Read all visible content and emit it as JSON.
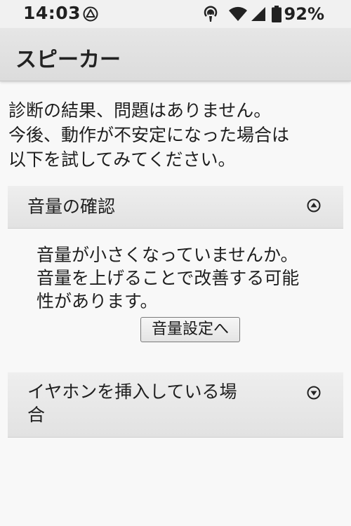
{
  "status_bar": {
    "time": "14:03",
    "battery_percent": "92%",
    "icons": [
      "nav-triangle-icon",
      "hotspot-icon",
      "wifi-icon",
      "cell-signal-icon",
      "battery-icon"
    ]
  },
  "app_bar": {
    "title": "スピーカー"
  },
  "intro": {
    "lines": [
      "診断の結果、問題はありません。",
      "今後、動作が不安定になった場合は",
      "以下を試してみてください。"
    ]
  },
  "sections": [
    {
      "title": "音量の確認",
      "expanded": true,
      "toggle_icon": "chevron-up-circle-icon",
      "body_lines": [
        "音量が小さくなっていませんか。",
        "音量を上げることで改善する可能",
        "性があります。"
      ],
      "button_label": "音量設定へ"
    },
    {
      "title_lines": [
        "イヤホンを挿入している場",
        "合"
      ],
      "expanded": false,
      "toggle_icon": "chevron-down-circle-icon"
    }
  ],
  "colors": {
    "background": "#f8f8f8",
    "app_bar": "#dedede",
    "accordion": "#e8e8e8",
    "text": "#202020"
  }
}
